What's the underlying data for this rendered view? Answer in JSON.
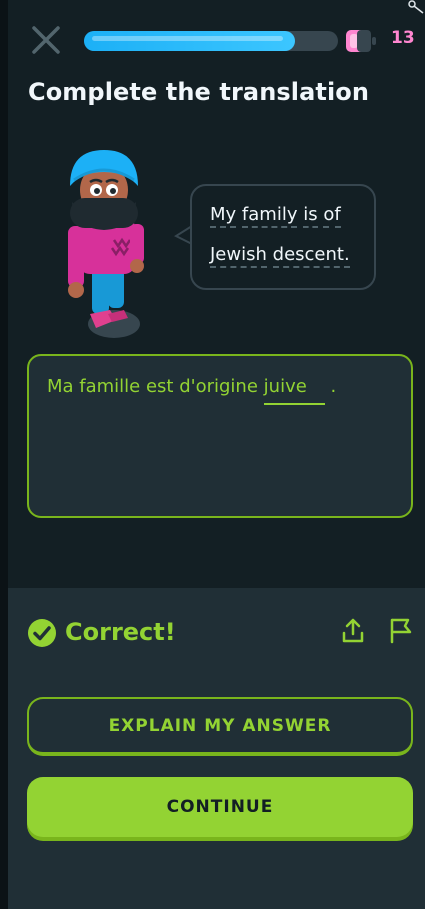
{
  "header": {
    "progress_fraction": 0.83,
    "hearts_count": "13",
    "colors": {
      "progress": "#1cb0f6",
      "hearts": "#ff86d0"
    }
  },
  "title": "Complete the translation",
  "bubble": {
    "line1": [
      "My",
      "family",
      "is",
      "of"
    ],
    "line2": [
      "Jewish",
      "descent."
    ]
  },
  "answer": {
    "prefix": "Ma famille est d'origine",
    "filled_word": "juive",
    "suffix": "."
  },
  "feedback": {
    "status": "Correct!",
    "explain_button": "EXPLAIN MY ANSWER",
    "continue_button": "CONTINUE",
    "colors": {
      "accent": "#93d333",
      "accent_dark": "#79b51c"
    }
  },
  "icons": [
    "close-icon",
    "heart-icon",
    "check-circle-icon",
    "share-icon",
    "flag-icon"
  ]
}
